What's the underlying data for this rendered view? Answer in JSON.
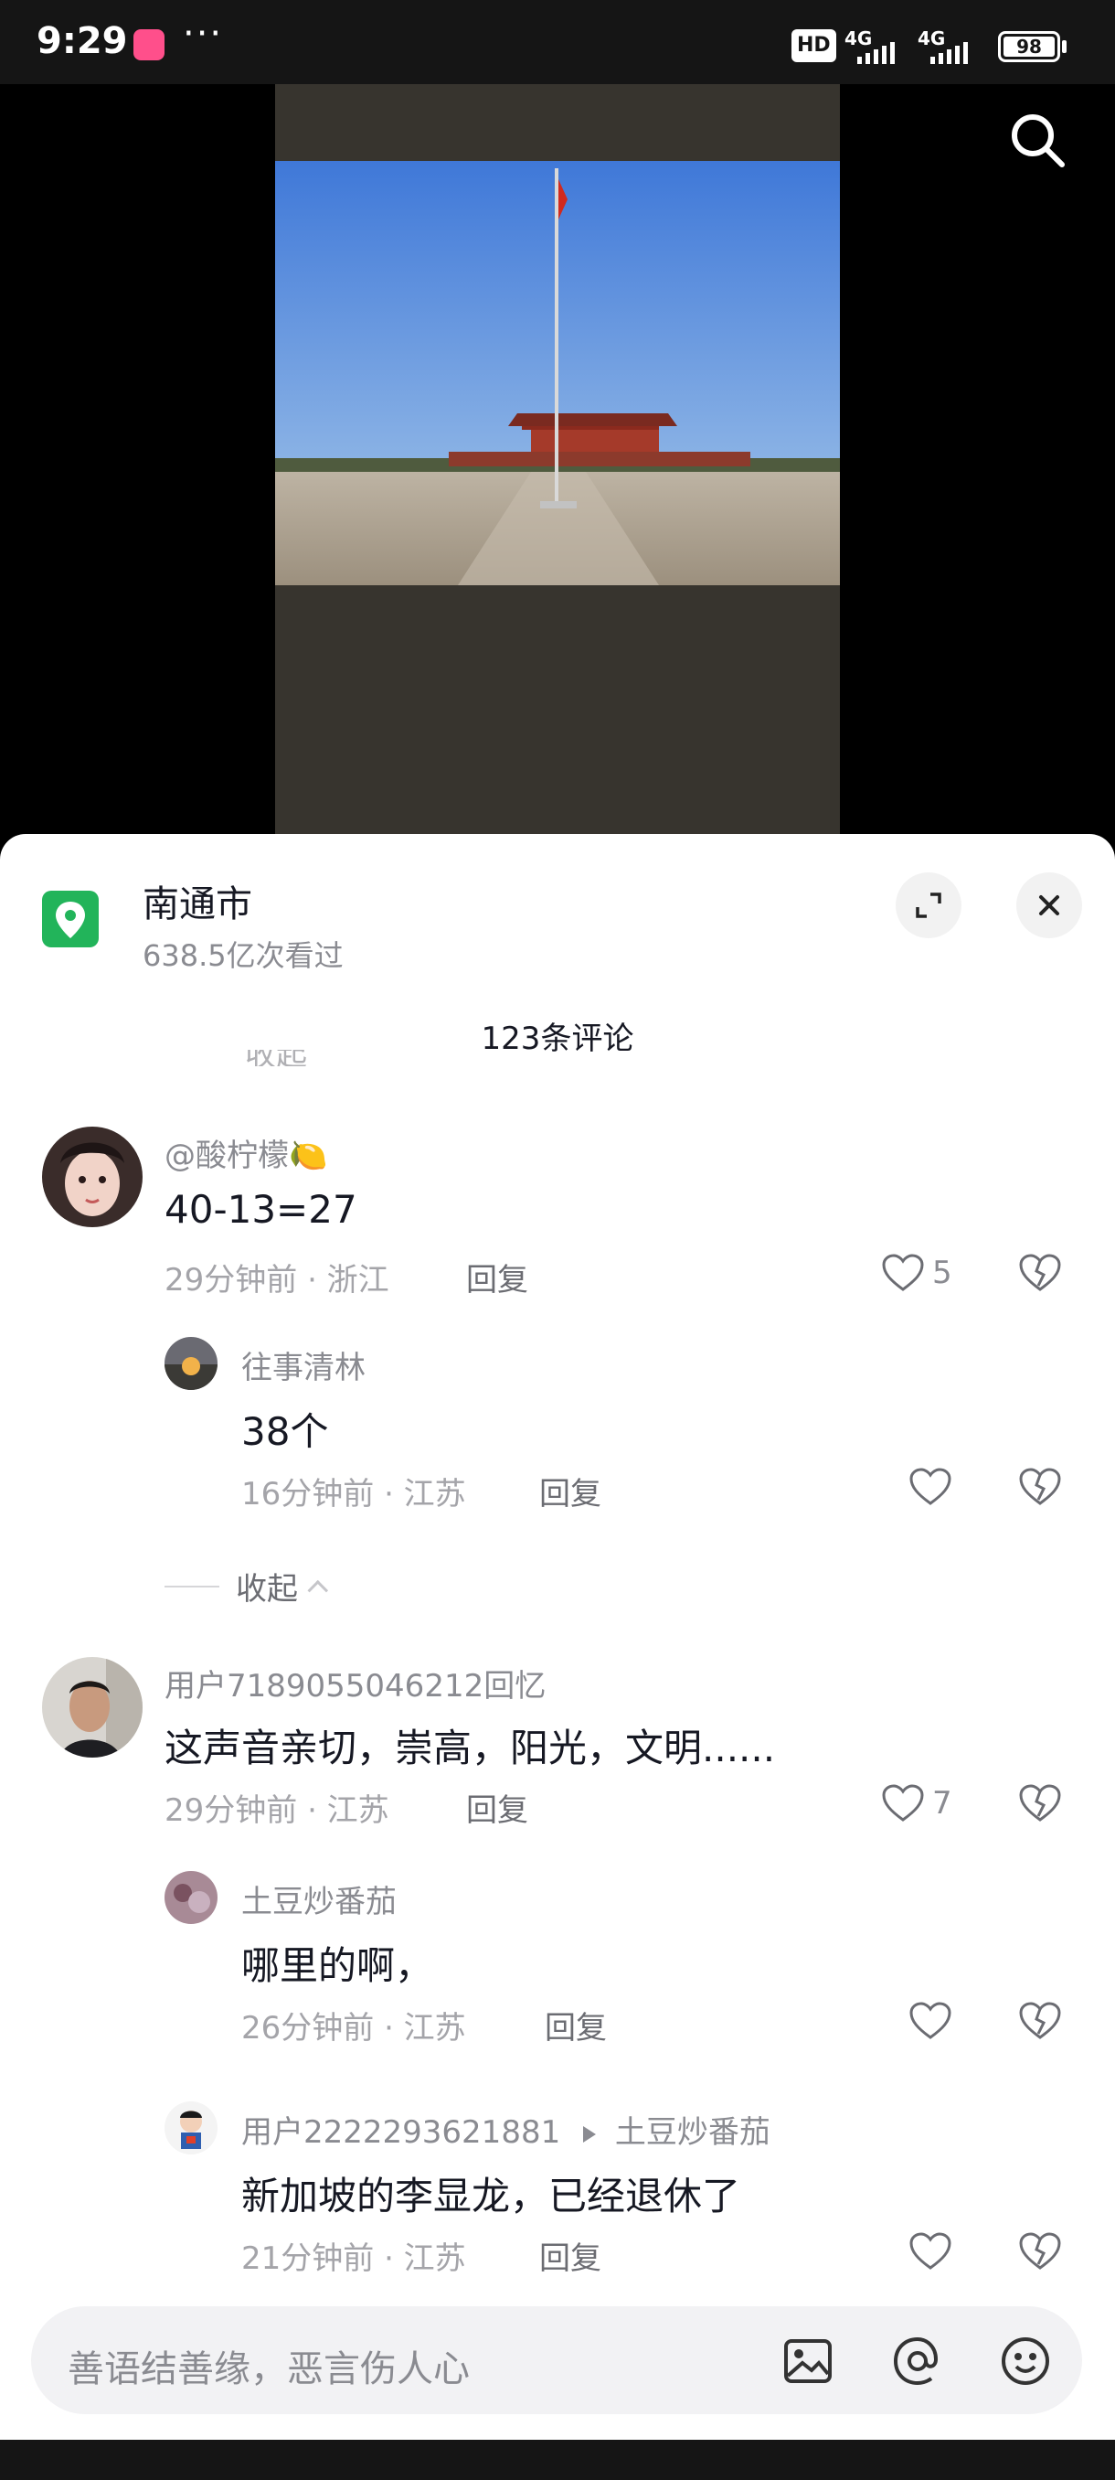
{
  "status_bar": {
    "time": "9:29",
    "more": "···",
    "hd_label": "HD",
    "network_1": "4G",
    "network_2": "4G",
    "battery": "98"
  },
  "location": {
    "name": "南通市",
    "views": "638.5亿次看过"
  },
  "comments_header": {
    "count_label": "123条评论",
    "peek_text": "收起"
  },
  "comments": [
    {
      "user": "@酸柠檬🍋",
      "text": "40-13=27",
      "meta": "29分钟前 · 浙江",
      "reply_label": "回复",
      "likes": "5",
      "replies": [
        {
          "user": "往事清林",
          "text": "38个",
          "meta": "16分钟前 · 江苏",
          "reply_label": "回复"
        }
      ]
    },
    {
      "user": "用户7189055046212回忆",
      "text": "这声音亲切，崇高，阳光，文明......",
      "meta": "29分钟前 · 江苏",
      "reply_label": "回复",
      "likes": "7",
      "replies": [
        {
          "user": "土豆炒番茄",
          "text": "哪里的啊，",
          "meta": "26分钟前 · 江苏",
          "reply_label": "回复"
        },
        {
          "user": "用户2222293621881",
          "reply_to": "土豆炒番茄",
          "text": "新加坡的李显龙，已经退休了",
          "meta": "21分钟前 · 江苏",
          "reply_label": "回复"
        }
      ]
    }
  ],
  "collapse_label": "收起",
  "input": {
    "placeholder": "善语结善缘，恶言伤人心"
  },
  "icons": {
    "search": "search-icon",
    "location": "location-pin-icon",
    "expand": "expand-icon",
    "close": "close-icon",
    "like": "heart-icon",
    "dislike": "broken-heart-icon",
    "image": "image-icon",
    "mention": "at-icon",
    "emoji": "emoji-icon"
  },
  "colors": {
    "accent_green": "#22b45a",
    "status_bar": "#151515"
  }
}
